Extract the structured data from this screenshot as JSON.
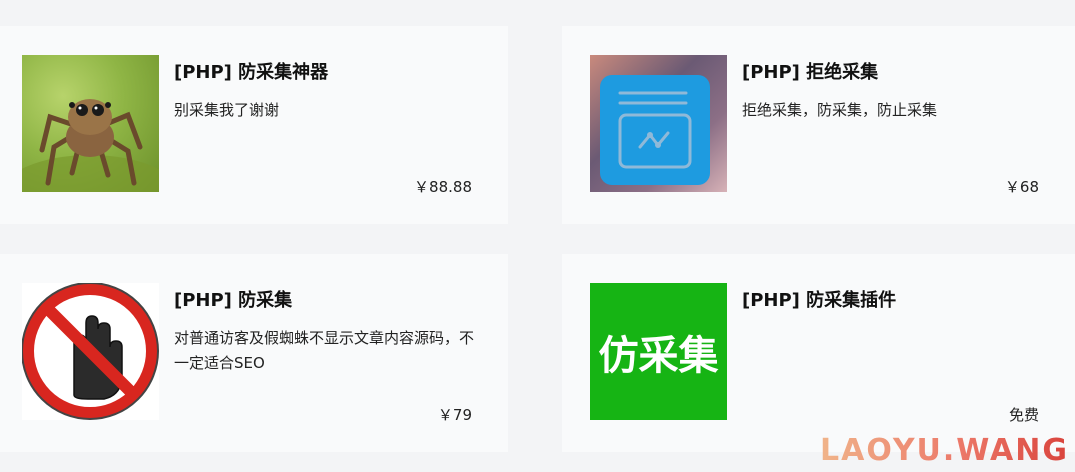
{
  "products": [
    {
      "title": "[PHP] 防采集神器",
      "description": "别采集我了谢谢",
      "price": "￥88.88",
      "image_icon": "jumping-spider-photo"
    },
    {
      "title": "[PHP] 拒绝采集",
      "description": "拒绝采集，防采集，防止采集",
      "price": "￥68",
      "image_icon": "app-window-icon"
    },
    {
      "title": "[PHP] 防采集",
      "description": "对普通访客及假蜘蛛不显示文章内容源码，不一定适合SEO",
      "price": "￥79",
      "image_icon": "stop-hand-sign"
    },
    {
      "title": "[PHP] 防采集插件",
      "description": "",
      "price": "免费",
      "image_icon": "text-logo",
      "image_text": "仿采集"
    }
  ],
  "watermark": "LAOYU.WANG",
  "colors": {
    "page_bg": "#f3f4f6",
    "card_bg": "#f9fafb",
    "app_blue": "#1e9be0",
    "stop_red": "#d8261f",
    "logo_green": "#16b414"
  }
}
